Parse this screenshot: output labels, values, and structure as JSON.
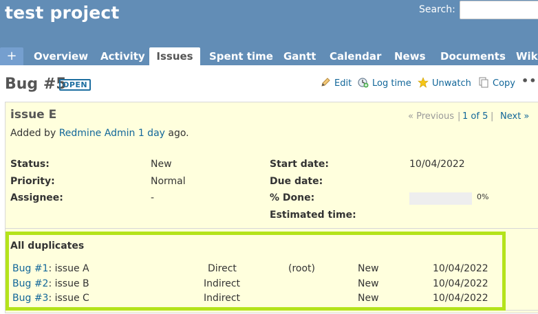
{
  "header": {
    "project_title": "test project",
    "search_label": "Search:",
    "search_value": ""
  },
  "tabs": [
    {
      "label": "+"
    },
    {
      "label": "Overview"
    },
    {
      "label": "Activity"
    },
    {
      "label": "Issues",
      "selected": true
    },
    {
      "label": "Spent time"
    },
    {
      "label": "Gantt"
    },
    {
      "label": "Calendar"
    },
    {
      "label": "News"
    },
    {
      "label": "Documents"
    },
    {
      "label": "Wiki"
    }
  ],
  "issue": {
    "title": "Bug #5",
    "status_badge": "OPEN",
    "subject": "issue E",
    "added_by_prefix": "Added by",
    "author": "Redmine Admin",
    "age": "1 day",
    "added_by_suffix": "ago."
  },
  "actions": {
    "edit": "Edit",
    "log_time": "Log time",
    "unwatch": "Unwatch",
    "copy": "Copy",
    "more": "•••"
  },
  "navigation": {
    "previous": "« Previous",
    "separator": "|",
    "count": "1 of 5",
    "next": "Next »"
  },
  "attributes": {
    "status_label": "Status:",
    "status_value": "New",
    "priority_label": "Priority:",
    "priority_value": "Normal",
    "assignee_label": "Assignee:",
    "assignee_value": "-",
    "start_date_label": "Start date:",
    "start_date_value": "10/04/2022",
    "due_date_label": "Due date:",
    "due_date_value": "",
    "done_label": "% Done:",
    "done_value": "0%",
    "done_fraction": 0,
    "estimated_label": "Estimated time:",
    "estimated_value": ""
  },
  "duplicates": {
    "title": "All duplicates",
    "rows": [
      {
        "issue": "Bug #1",
        "subject": ": issue A",
        "relation": "Direct",
        "parent": "(root)",
        "status": "New",
        "date": "10/04/2022"
      },
      {
        "issue": "Bug #2",
        "subject": ": issue B",
        "relation": "Indirect",
        "parent": "",
        "status": "New",
        "date": "10/04/2022"
      },
      {
        "issue": "Bug #3",
        "subject": ": issue C",
        "relation": "Indirect",
        "parent": "",
        "status": "New",
        "date": "10/04/2022"
      }
    ]
  },
  "colors": {
    "header_bg": "#628db6",
    "link": "#116699",
    "issue_bg": "#ffffdd",
    "highlight": "#b4e31b"
  }
}
